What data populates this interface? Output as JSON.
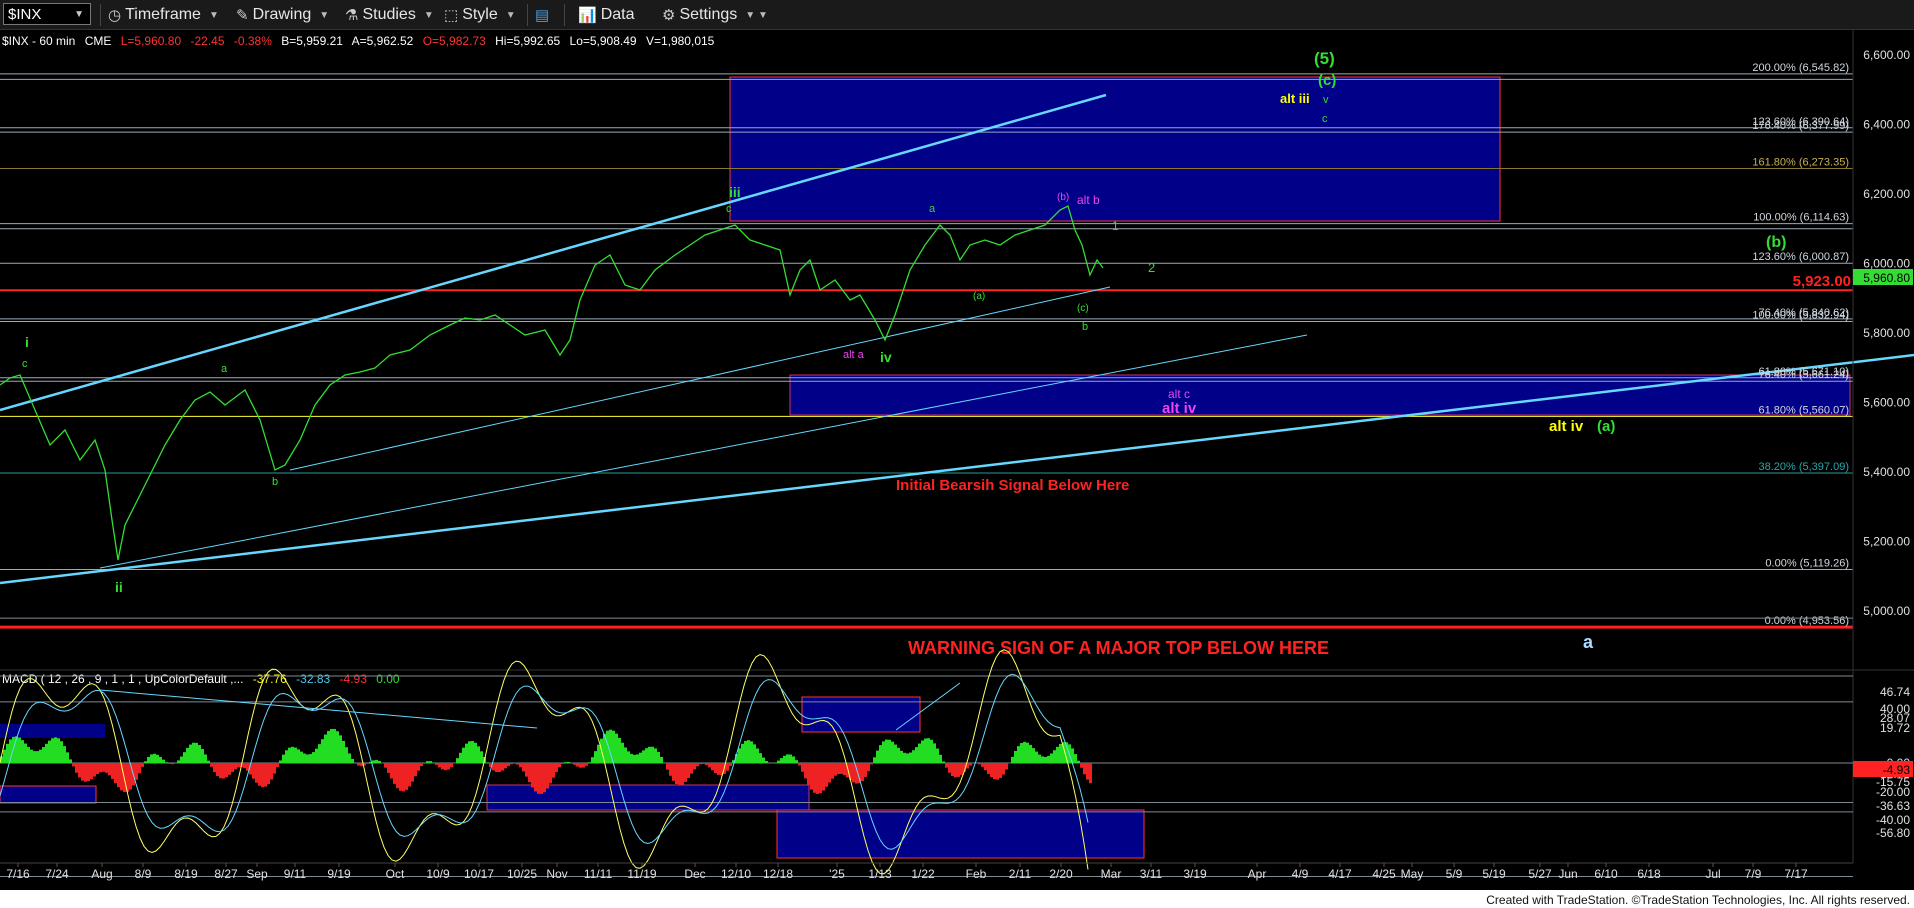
{
  "toolbar": {
    "symbol": "$INX",
    "timeframe": "Timeframe",
    "drawing": "Drawing",
    "studies": "Studies",
    "style": "Style",
    "data": "Data",
    "settings": "Settings"
  },
  "quote": {
    "symbol_interval": "$INX - 60 min",
    "exchange": "CME",
    "last": "L=5,960.80",
    "change": "-22.45",
    "change_pct": "-0.38%",
    "bid": "B=5,959.21",
    "ask": "A=5,962.52",
    "open": "O=5,982.73",
    "high": "Hi=5,992.65",
    "low": "Lo=5,908.49",
    "volume": "V=1,980,015"
  },
  "macd_header": {
    "label": "MACD ( 12 , 26 , 9 , 1 , 1 , UpColorDefault ,...",
    "v1": "-37.76",
    "v2": "-32.83",
    "v3": "-4.93",
    "v4": "0.00"
  },
  "price_axis": [
    "6,600.00",
    "6,400.00",
    "6,200.00",
    "6,000.00",
    "5,800.00",
    "5,600.00",
    "5,400.00",
    "5,200.00",
    "5,000.00"
  ],
  "price_tags": {
    "last": "5,960.80"
  },
  "macd_axis": [
    "46.74",
    "40.00",
    "28.07",
    "19.72",
    "20.00",
    "0.00",
    "-12.75",
    "-15.75",
    "-20.00",
    "-36.63",
    "-40.00",
    "-56.80"
  ],
  "macd_tag": "-4.93",
  "fib_labels": [
    {
      "text": "200.00% (6,545.82)",
      "y_price": 6545.82
    },
    {
      "text": "123.60% (6,390.64)",
      "y_price": 6390.64
    },
    {
      "text": "176.40% (6,377.99)",
      "y_price": 6377.99
    },
    {
      "text": "161.80% (6,273.35)",
      "y_price": 6273.35
    },
    {
      "text": "100.00% (6,114.63)",
      "y_price": 6114.63
    },
    {
      "text": "123.60% (6,000.87)",
      "y_price": 6000.87
    },
    {
      "text": "76.40% (5,840.62)",
      "y_price": 5840.62
    },
    {
      "text": "100.00% (5,832.94)",
      "y_price": 5832.94
    },
    {
      "text": "61.80% (5,671.10)",
      "y_price": 5671.1
    },
    {
      "text": "76.40% (5,661.24)",
      "y_price": 5661.24
    },
    {
      "text": "61.80% (5,560.07)",
      "y_price": 5560.07
    },
    {
      "text": "38.20% (5,397.09)",
      "y_price": 5397.09
    },
    {
      "text": "0.00% (5,119.26)",
      "y_price": 5119.26
    },
    {
      "text": "0.00% (4,953.56)",
      "y_price": 4953.56
    }
  ],
  "level_5923": "5,923.00",
  "annotations": {
    "bearish": "Initial Bearsih Signal Below Here",
    "warning": "WARNING SIGN OF A MAJOR TOP BELOW HERE",
    "wave5": "(5)",
    "wave_c_paren": "(c)",
    "alt_iii": "alt iii",
    "v": "v",
    "c_small": "c",
    "iii": "iii",
    "c_left": "c",
    "a_top": "a",
    "b_paren_top": "(b)",
    "alt_b": "alt b",
    "one": "1",
    "two": "2",
    "b_paren_green": "(b)",
    "a_paren": "(a)",
    "c_paren_low": "(c)",
    "b_low": "b",
    "alt_a": "alt a",
    "iv": "iv",
    "alt_c": "alt c",
    "alt_iv_purple": "alt iv",
    "alt_iv_yellow": "alt iv",
    "a_paren_green": "(a)",
    "i": "i",
    "c_i": "c",
    "a_mid": "a",
    "b_sep": "b",
    "ii": "ii",
    "a_blue": "a"
  },
  "dates": [
    "7/16",
    "7/24",
    "Aug",
    "8/9",
    "8/19",
    "8/27",
    "Sep",
    "9/11",
    "9/19",
    "Oct",
    "10/9",
    "10/17",
    "10/25",
    "Nov",
    "11/11",
    "11/19",
    "Dec",
    "12/10",
    "12/18",
    "'25",
    "1/13",
    "1/22",
    "Feb",
    "2/11",
    "2/20",
    "Mar",
    "3/11",
    "3/19",
    "Apr",
    "4/9",
    "4/17",
    "4/25",
    "May",
    "5/9",
    "5/19",
    "5/27",
    "Jun",
    "6/10",
    "6/18",
    "Jul",
    "7/9",
    "7/17"
  ],
  "footer": "Created with TradeStation. ©TradeStation Technologies, Inc. All rights reserved.",
  "colors": {
    "price_line": "#33dd33",
    "trend": "#44ccee",
    "red": "#ff2222",
    "box": "#000088",
    "yellow": "#ffff00"
  }
}
